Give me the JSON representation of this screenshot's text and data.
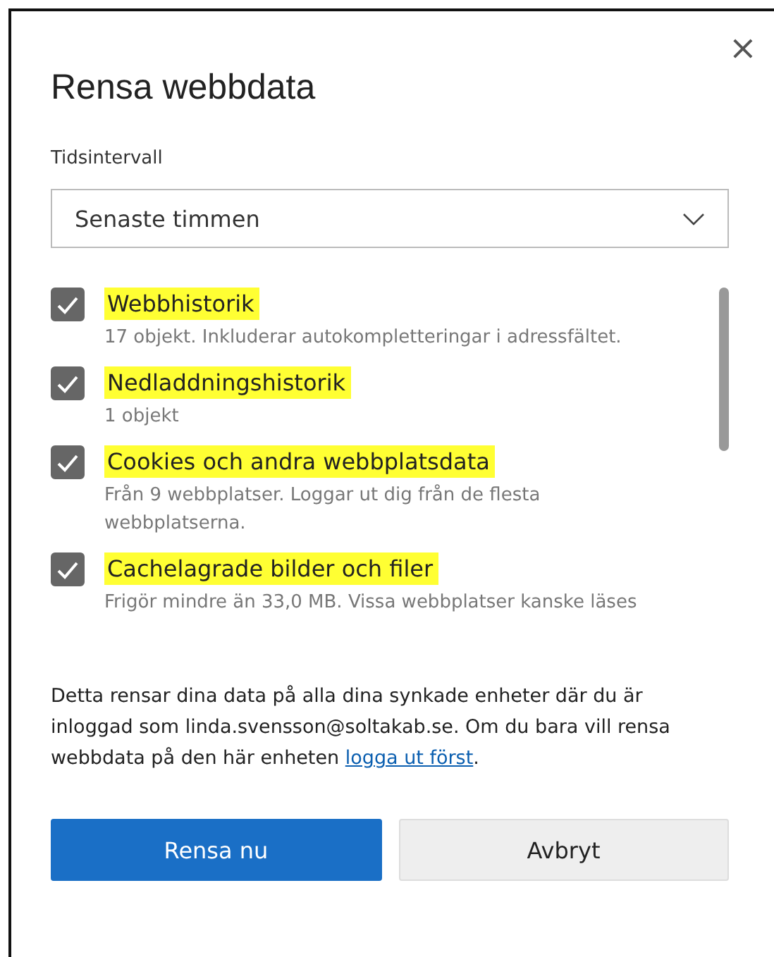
{
  "dialog": {
    "title": "Rensa webbdata",
    "close": "×"
  },
  "time_range": {
    "label": "Tidsintervall",
    "value": "Senaste timmen"
  },
  "items": [
    {
      "label": "Webbhistorik",
      "description": "17 objekt. Inkluderar autokompletteringar i adressfältet.",
      "checked": true,
      "highlighted": true
    },
    {
      "label": "Nedladdningshistorik",
      "description": "1 objekt",
      "checked": true,
      "highlighted": true
    },
    {
      "label": "Cookies och andra webbplatsdata",
      "description": "Från 9 webbplatser. Loggar ut dig från de flesta webbplatserna.",
      "checked": true,
      "highlighted": true
    },
    {
      "label": "Cachelagrade bilder och filer",
      "description": "Frigör mindre än 33,0 MB. Vissa webbplatser kanske läses",
      "checked": true,
      "highlighted": true
    }
  ],
  "notice": {
    "text": "Detta rensar dina data på alla dina synkade enheter där du är inloggad som linda.svensson@soltakab.se. Om du bara vill rensa webbdata på den här enheten ",
    "link": "logga ut först",
    "end": "."
  },
  "buttons": [
    {
      "label": "Rensa nu",
      "kind": "primary"
    },
    {
      "label": "Avbryt",
      "kind": "secondary"
    }
  ]
}
